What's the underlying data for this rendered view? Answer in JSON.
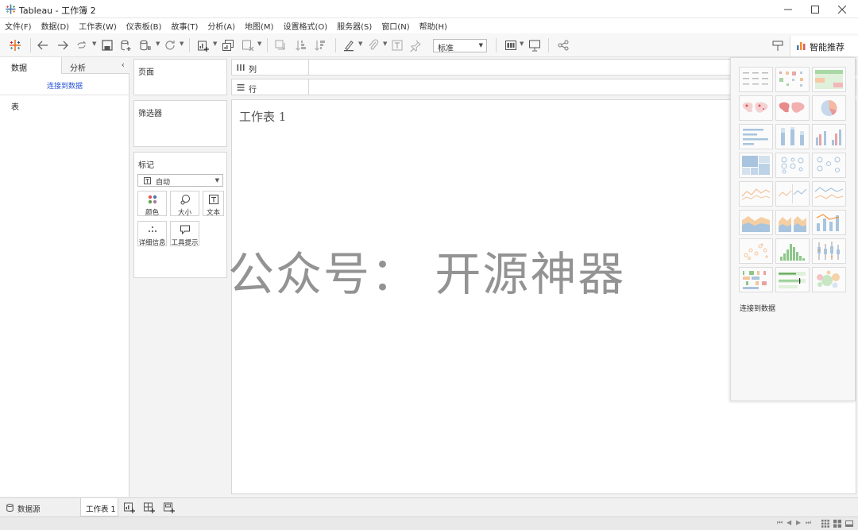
{
  "window": {
    "title": "Tableau - 工作簿 2"
  },
  "menu": [
    "文件(F)",
    "数据(D)",
    "工作表(W)",
    "仪表板(B)",
    "故事(T)",
    "分析(A)",
    "地图(M)",
    "设置格式(O)",
    "服务器(S)",
    "窗口(N)",
    "帮助(H)"
  ],
  "toolbar": {
    "fit_value": "标准",
    "smart_recommend_label": "智能推荐"
  },
  "data_pane": {
    "tabs": [
      "数据",
      "分析"
    ],
    "connect_link": "连接到数据",
    "tables_label": "表"
  },
  "cards": {
    "pages": "页面",
    "filters": "筛选器",
    "marks": "标记",
    "mark_type": "自动",
    "mark_buttons": [
      "颜色",
      "大小",
      "文本",
      "详细信息",
      "工具提示"
    ]
  },
  "shelves": {
    "columns": "列",
    "rows": "行"
  },
  "view": {
    "sheet_title": "工作表 1"
  },
  "showme": {
    "connect_text": "连接到数据"
  },
  "watermark": "公众号： 开源神器",
  "tabs": {
    "datasource": "数据源",
    "sheet": "工作表 1"
  },
  "colors": {
    "accent_blue": "#2a52d8",
    "tableau_blue": "#4e79a7",
    "tableau_orange": "#f28e2b",
    "tableau_green": "#59a14f",
    "tableau_red": "#e15759"
  }
}
